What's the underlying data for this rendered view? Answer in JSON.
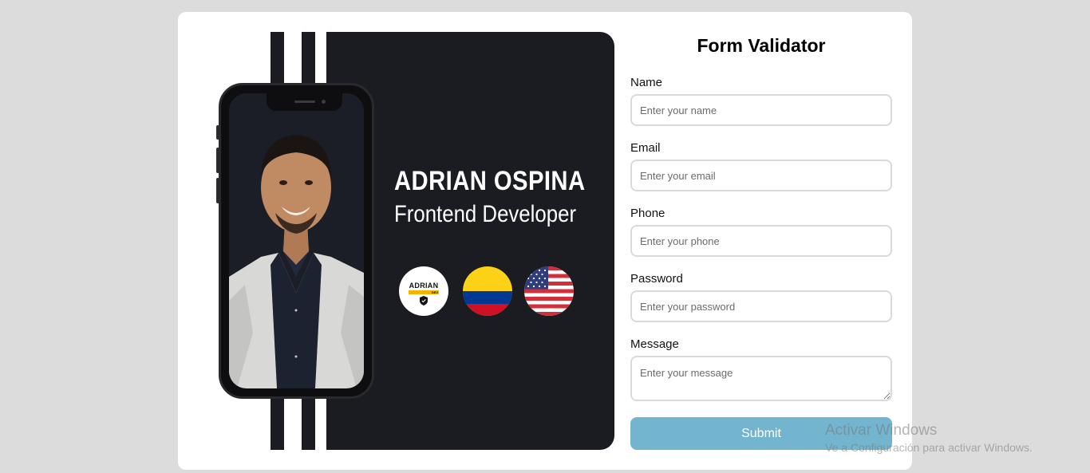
{
  "profile": {
    "name": "ADRIAN OSPINA",
    "role": "Frontend Developer",
    "badges": [
      {
        "icon": "adrian-dev-logo",
        "line1": "ADRIAN",
        "line2": "DEV"
      },
      {
        "icon": "colombia-flag"
      },
      {
        "icon": "usa-flag"
      }
    ]
  },
  "form": {
    "title": "Form Validator",
    "fields": [
      {
        "label": "Name",
        "placeholder": "Enter your name"
      },
      {
        "label": "Email",
        "placeholder": "Enter your email"
      },
      {
        "label": "Phone",
        "placeholder": "Enter your phone"
      },
      {
        "label": "Password",
        "placeholder": "Enter your password"
      },
      {
        "label": "Message",
        "placeholder": "Enter your message"
      }
    ],
    "submit_label": "Submit"
  },
  "watermark": {
    "line1": "Activar Windows",
    "line2": "Ve a Configuración para activar Windows."
  },
  "colors": {
    "background": "#dcdcdc",
    "panel": "#1b1c21",
    "submit": "#73b5ce",
    "accent_yellow": "#f5b400"
  }
}
